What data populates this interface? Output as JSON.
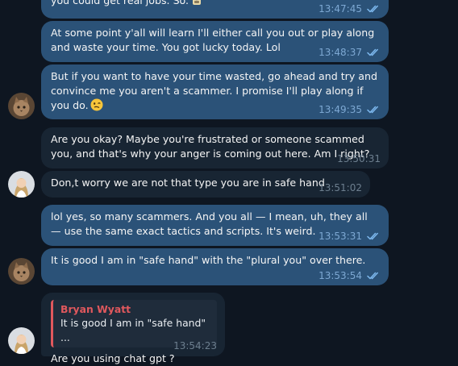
{
  "messages": [
    {
      "text": "you could get real jobs. So.",
      "time": "13:47:45",
      "emoji": "scroll-emoji-icon"
    },
    {
      "text": "At some point y'all will learn I'll either call you out or play along and waste your time. You got lucky today. Lol",
      "time": "13:48:37"
    },
    {
      "text": "But if you want to have your time wasted, go ahead and try and convince me you aren't a scammer. I promise I'll play along if you do.",
      "time": "13:49:35",
      "emoji": "woozy-face-emoji-icon"
    },
    {
      "text": "Are you okay? Maybe you're frustrated or someone scammed you, and that's why your anger is coming out here. Am I right?",
      "time": "13:50:31"
    },
    {
      "text": "Don,t worry we are not that type you are in safe hand",
      "time": "13:51:02"
    },
    {
      "text": "lol yes, so many scammers. And you all — I mean, uh, they all — use the same exact tactics and scripts. It's weird.",
      "time": "13:53:31"
    },
    {
      "text": "It is good I am in \"safe hand\" with the \"plural you\" over there.",
      "time": "13:53:54"
    },
    {
      "text": "Are you using chat gpt ?",
      "time": "13:54:23",
      "reply": {
        "author": "Bryan Wyatt",
        "text": "It is good I am in \"safe hand\" ..."
      }
    }
  ],
  "colors": {
    "background": "#0e1621",
    "outgoing_bubble": "#2b5278",
    "incoming_bubble": "#182533",
    "reply_author": "#e0585d"
  },
  "icons": [
    "double-check-icon",
    "cat-avatar",
    "woman-avatar"
  ]
}
